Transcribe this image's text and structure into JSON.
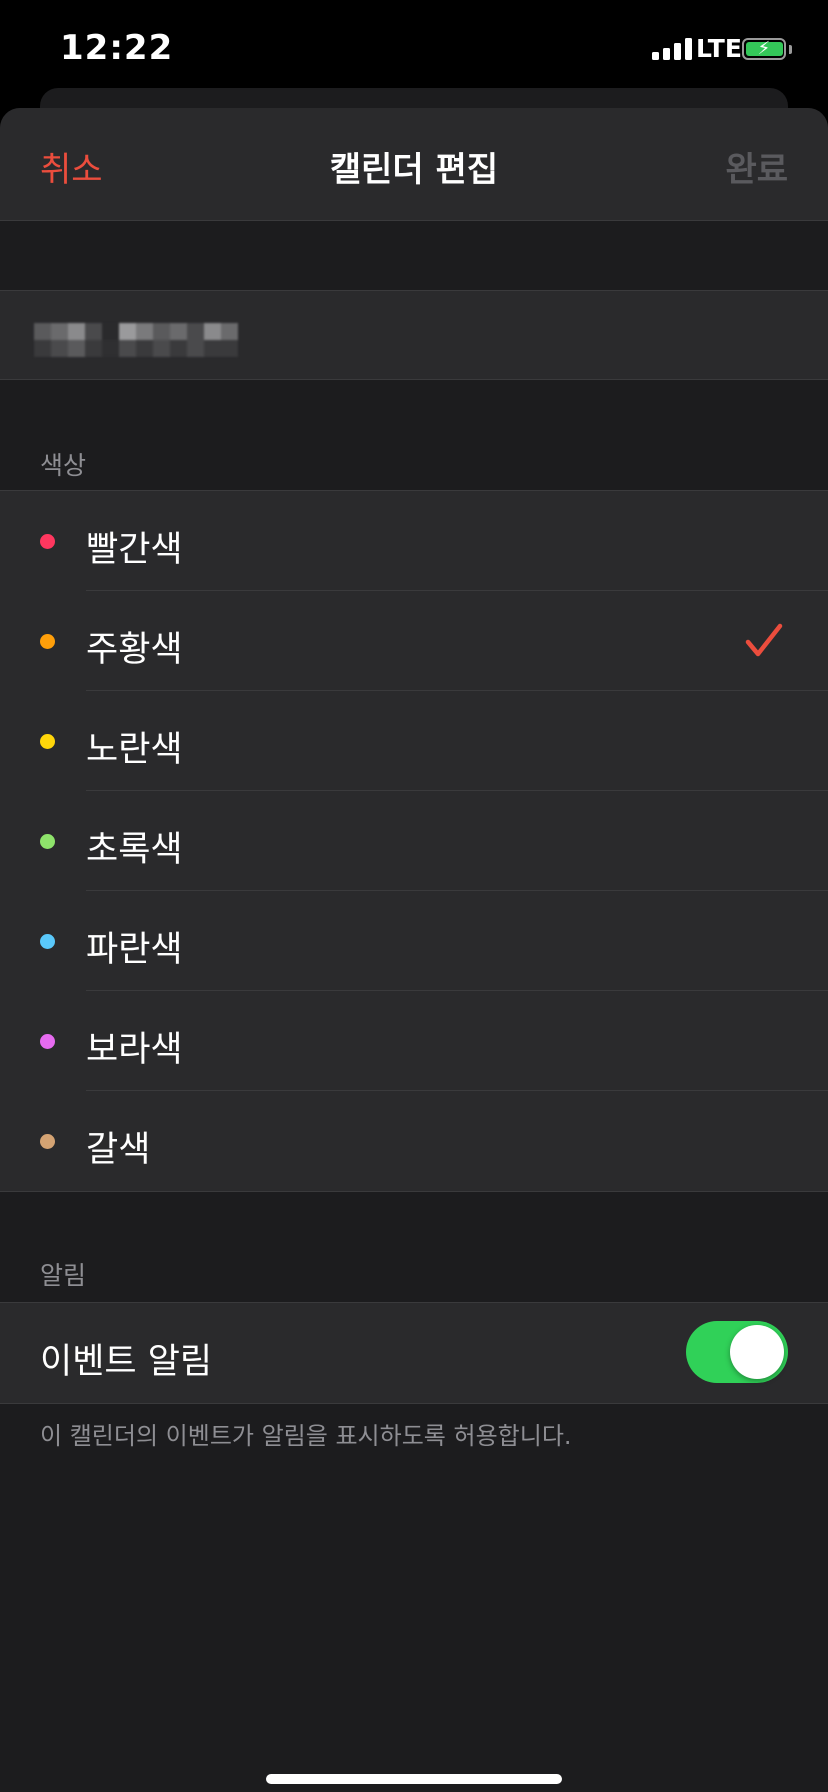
{
  "status_bar": {
    "time": "12:22",
    "network": "LTE",
    "signal_bars": 4,
    "battery_charging": true,
    "battery_icon": "bolt-icon"
  },
  "nav": {
    "cancel_label": "취소",
    "title": "캘린더 편집",
    "done_label": "완료"
  },
  "calendar_name": {
    "value_redacted": true
  },
  "colors_section": {
    "header": "색상",
    "selected": "주황색",
    "items": [
      {
        "label": "빨간색",
        "color": "#ff375f",
        "selected": false
      },
      {
        "label": "주황색",
        "color": "#ff9f0a",
        "selected": true
      },
      {
        "label": "노란색",
        "color": "#ffd60a",
        "selected": false
      },
      {
        "label": "초록색",
        "color": "#8ee36b",
        "selected": false
      },
      {
        "label": "파란색",
        "color": "#5ac8fa",
        "selected": false
      },
      {
        "label": "보라색",
        "color": "#e66bf0",
        "selected": false
      },
      {
        "label": "갈색",
        "color": "#d4a373",
        "selected": false
      }
    ]
  },
  "alerts_section": {
    "header": "알림",
    "event_alerts_label": "이벤트 알림",
    "event_alerts_on": true,
    "footer": "이 캘린더의 이벤트가 알림을 표시하도록 허용합니다."
  },
  "theme": {
    "accent_red": "#eb4d3d",
    "toggle_green": "#30d158",
    "checkmark_color": "#eb4d3d"
  }
}
